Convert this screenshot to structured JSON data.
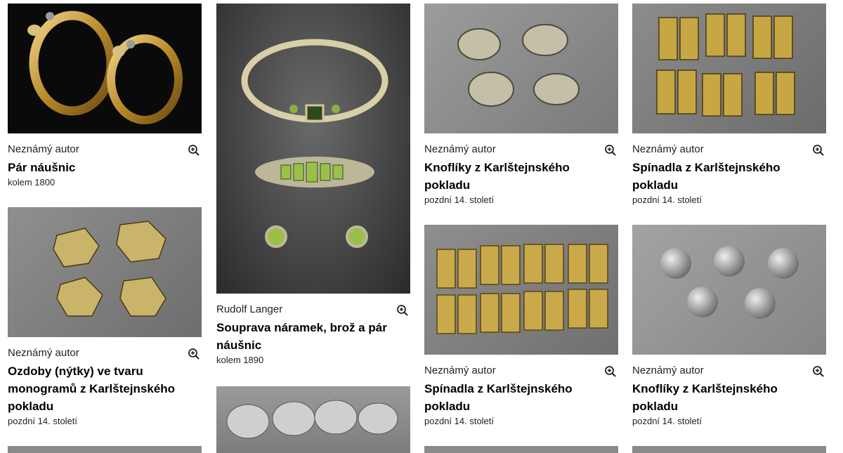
{
  "cards": [
    {
      "author": "Neznámý autor",
      "title": "Pár náušnic",
      "date": "kolem 1800",
      "image": "gold-hoop-earrings-with-snake-heads"
    },
    {
      "author": "Neznámý autor",
      "title": "Ozdoby (nýtky) ve tvaru monogramů z Karlštejnského pokladu",
      "date": "pozdní 14. století",
      "image": "monogram-rivet-ornaments"
    },
    {
      "author": "",
      "title": "",
      "date": "",
      "image": "cropped-next-item"
    },
    {
      "author": "Rudolf Langer",
      "title": "Souprava náramek, brož a pár náušnic",
      "date": "kolem 1890",
      "image": "bracelet-brooch-earrings-set"
    },
    {
      "author": "",
      "title": "",
      "date": "",
      "image": "silver-dome-buttons"
    },
    {
      "author": "Neznámý autor",
      "title": "Knoflíky z Karlštejnského pokladu",
      "date": "pozdní 14. století",
      "image": "flat-silver-buttons"
    },
    {
      "author": "Neznámý autor",
      "title": "Spínadla z Karlštejnského pokladu",
      "date": "pozdní 14. století",
      "image": "gilded-clasps-with-birds"
    },
    {
      "author": "",
      "title": "",
      "date": "",
      "image": "cropped-next-item"
    },
    {
      "author": "Neznámý autor",
      "title": "Spínadla z Karlštejnského pokladu",
      "date": "pozdní 14. století",
      "image": "gilded-clasps-with-lilies"
    },
    {
      "author": "Neznámý autor",
      "title": "Knoflíky z Karlštejnského pokladu",
      "date": "pozdní 14. století",
      "image": "round-silver-buttons"
    },
    {
      "author": "",
      "title": "",
      "date": "",
      "image": "cropped-next-item"
    }
  ],
  "zoom_icon": "zoom-in-icon"
}
